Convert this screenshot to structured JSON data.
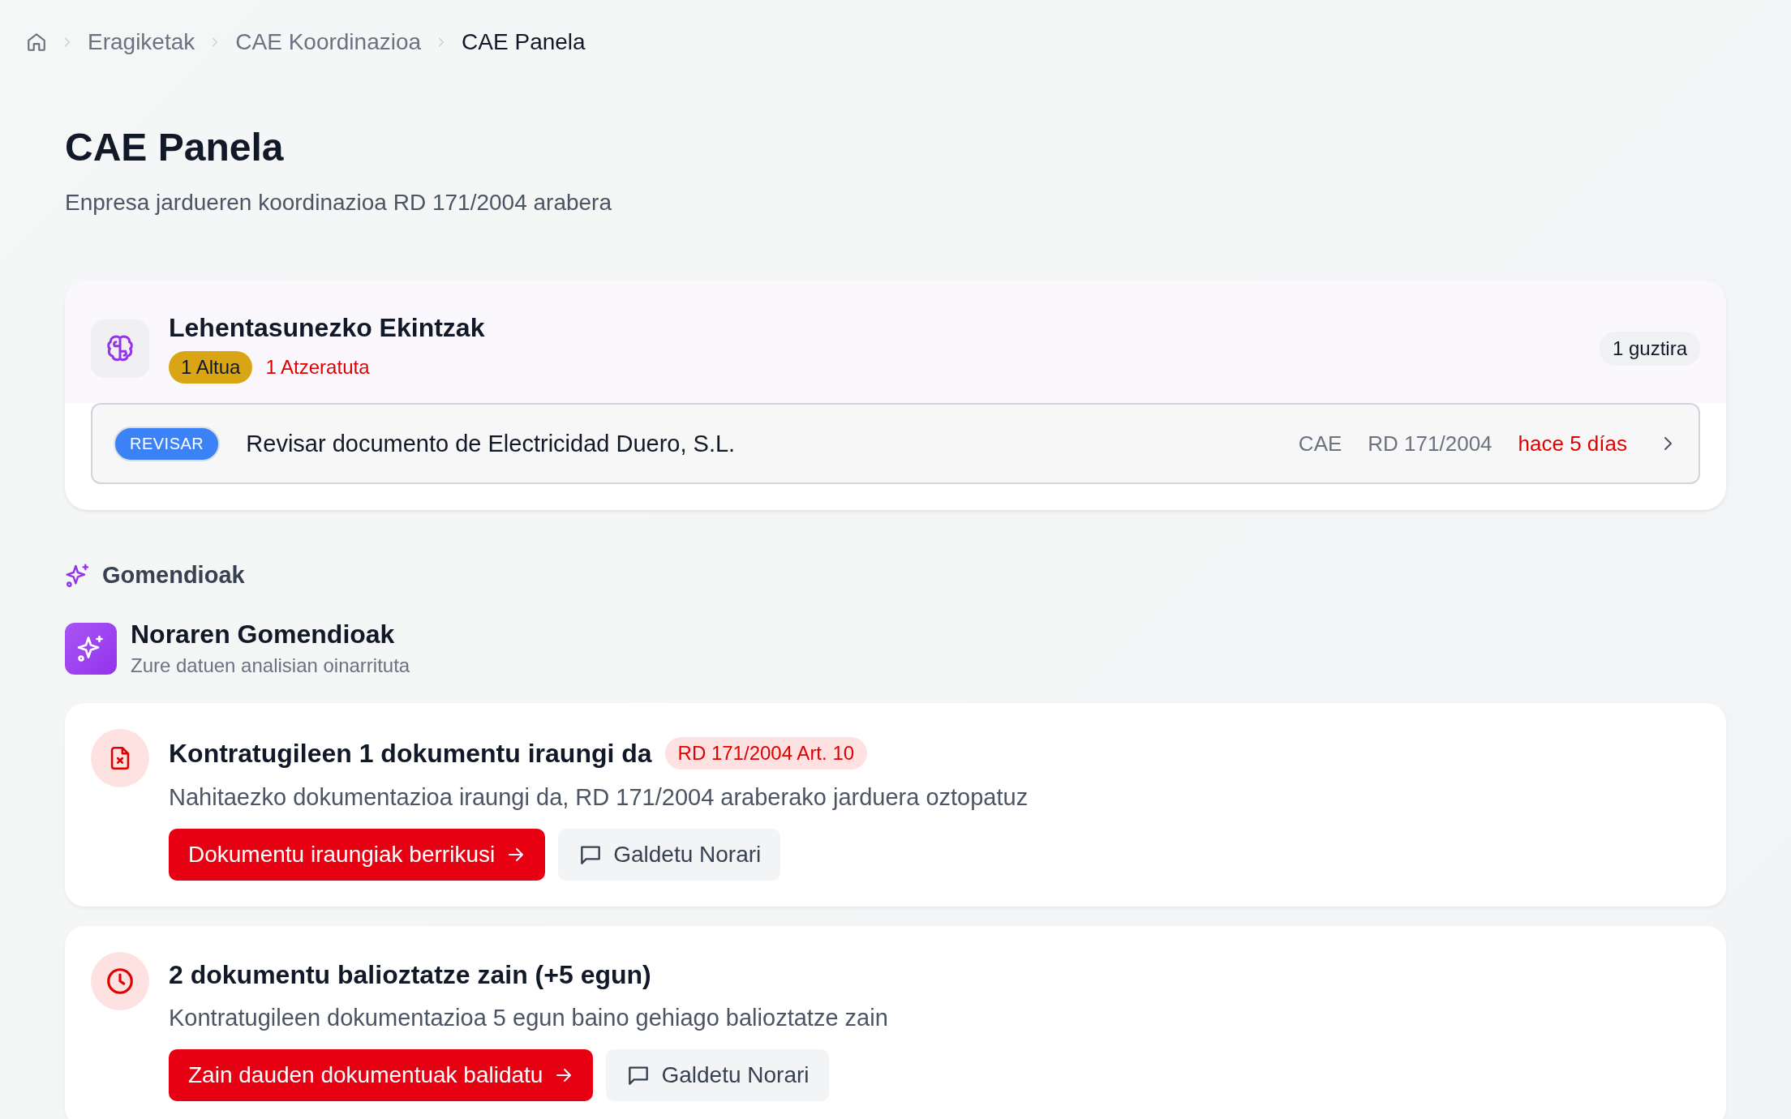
{
  "breadcrumb": [
    {
      "label": "Eragiketak",
      "current": false
    },
    {
      "label": "CAE Koordinazioa",
      "current": false
    },
    {
      "label": "CAE Panela",
      "current": true
    }
  ],
  "page": {
    "title": "CAE Panela",
    "subtitle": "Enpresa jardueren koordinazioa RD 171/2004 arabera"
  },
  "priority_panel": {
    "title": "Lehentasunezko Ekintzak",
    "badges": [
      {
        "kind": "level",
        "label": "1 Altua"
      },
      {
        "kind": "overdue",
        "label": "1 Atzeratuta"
      }
    ],
    "total": "1 guztira",
    "items": [
      {
        "tag": "REVISAR",
        "title": "Revisar documento de Electricidad Duero, S.L.",
        "category": "CAE",
        "regulation": "RD 171/2004",
        "age": "hace 5 días",
        "overdue": true
      }
    ]
  },
  "recommendations": {
    "section_title": "Gomendioak",
    "title": "Noraren Gomendioak",
    "subtitle": "Zure datuen analisian oinarrituta",
    "cards": [
      {
        "kind": "expired",
        "title": "Kontratugileen 1 dokumentu iraungi da",
        "tag": "RD 171/2004 Art. 10",
        "description": "Nahitaezko dokumentazioa iraungi da, RD 171/2004 araberako jarduera oztopatuz",
        "primary_action": "Dokumentu iraungiak berrikusi",
        "secondary_action": "Galdetu Norari"
      },
      {
        "kind": "pending",
        "title": "2 dokumentu balioztatze zain (+5 egun)",
        "description": "Kontratugileen dokumentazioa 5 egun baino gehiago balioztatze zain",
        "primary_action": "Zain dauden dokumentuak balidatu",
        "secondary_action": "Galdetu Norari"
      }
    ]
  }
}
